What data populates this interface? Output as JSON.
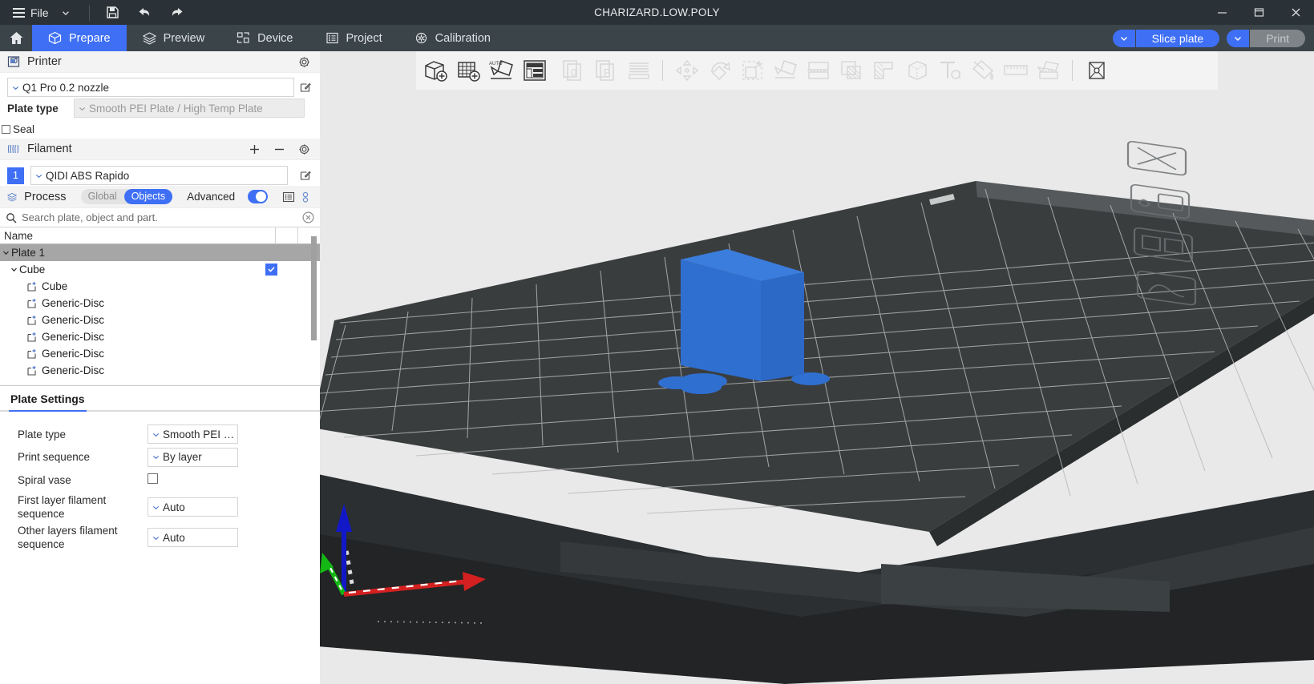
{
  "titlebar": {
    "file_menu": "File",
    "title": "CHARIZARD.LOW.POLY",
    "icons": [
      "hamburger-icon",
      "chevron-down-icon",
      "save-icon",
      "undo-icon",
      "redo-icon"
    ],
    "window_buttons": [
      "minimize-icon",
      "maximize-icon",
      "close-icon"
    ]
  },
  "tabs": {
    "home_icon": "home-icon",
    "items": [
      {
        "label": "Prepare",
        "icon": "cube-icon",
        "active": true
      },
      {
        "label": "Preview",
        "icon": "layers-icon",
        "active": false
      },
      {
        "label": "Device",
        "icon": "device-icon",
        "active": false
      },
      {
        "label": "Project",
        "icon": "project-icon",
        "active": false
      },
      {
        "label": "Calibration",
        "icon": "calibration-icon",
        "active": false
      }
    ],
    "slice_button": "Slice plate",
    "print_button": "Print"
  },
  "printer": {
    "section_title": "Printer",
    "gear_icon": "gear-icon",
    "preset": "Q1 Pro 0.2 nozzle",
    "edit_icon": "edit-icon",
    "plate_type_label": "Plate type",
    "plate_type_value": "Smooth PEI Plate / High Temp Plate",
    "seal_label": "Seal",
    "seal_checked": false
  },
  "filament": {
    "section_title": "Filament",
    "add_icon": "plus-icon",
    "remove_icon": "minus-icon",
    "gear_icon": "gear-icon",
    "rows": [
      {
        "index": "1",
        "name": "QIDI ABS Rapido",
        "edit_icon": "edit-icon"
      }
    ]
  },
  "process": {
    "section_title": "Process",
    "icon": "process-layers-icon",
    "segments": [
      {
        "label": "Global",
        "active": false
      },
      {
        "label": "Objects",
        "active": true
      }
    ],
    "advanced_label": "Advanced",
    "advanced_on": true,
    "list_icon": "list-view-icon",
    "settings_icon": "settings-dots-icon"
  },
  "search": {
    "icon": "search-icon",
    "placeholder": "Search plate, object and part.",
    "value": "",
    "clear_icon": "clear-circle-icon"
  },
  "object_table": {
    "columns": [
      "Name",
      "",
      ""
    ],
    "rows": [
      {
        "label": "Plate 1",
        "depth": 0,
        "type": "plate",
        "expanded": true,
        "selected": true,
        "checked": false
      },
      {
        "label": "Cube",
        "depth": 1,
        "type": "object",
        "expanded": true,
        "selected": false,
        "checked": true
      },
      {
        "label": "Cube",
        "depth": 2,
        "type": "part",
        "expanded": false,
        "selected": false,
        "checked": false
      },
      {
        "label": "Generic-Disc",
        "depth": 2,
        "type": "part",
        "expanded": false,
        "selected": false,
        "checked": false
      },
      {
        "label": "Generic-Disc",
        "depth": 2,
        "type": "part",
        "expanded": false,
        "selected": false,
        "checked": false
      },
      {
        "label": "Generic-Disc",
        "depth": 2,
        "type": "part",
        "expanded": false,
        "selected": false,
        "checked": false
      },
      {
        "label": "Generic-Disc",
        "depth": 2,
        "type": "part",
        "expanded": false,
        "selected": false,
        "checked": false
      },
      {
        "label": "Generic-Disc",
        "depth": 2,
        "type": "part",
        "expanded": false,
        "selected": false,
        "checked": false
      }
    ]
  },
  "plate_settings": {
    "title": "Plate Settings",
    "fields": [
      {
        "label": "Plate type",
        "control": "combo",
        "value": "Smooth PEI …"
      },
      {
        "label": "Print sequence",
        "control": "combo",
        "value": "By layer"
      },
      {
        "label": "Spiral vase",
        "control": "checkbox",
        "value": "",
        "checked": false
      },
      {
        "label": "First layer filament sequence",
        "control": "combo",
        "value": "Auto"
      },
      {
        "label": "Other layers filament sequence",
        "control": "combo",
        "value": "Auto"
      }
    ]
  },
  "view_toolbar": {
    "icons": [
      "add-object-icon",
      "add-plate-icon",
      "auto-arrange-icon",
      "layout-icon",
      "add-filament-0-icon",
      "add-filament-p-icon",
      "variable-layer-height-icon",
      "move-icon",
      "rotate-icon",
      "scale-icon",
      "place-on-face-icon",
      "cut-icon",
      "support-painting-icon",
      "seam-painting-icon",
      "fuzzy-skin-icon",
      "text-icon",
      "color-painting-icon",
      "measure-icon",
      "assembly-icon",
      "simplify-icon"
    ],
    "separator_positions": [
      6,
      19
    ]
  },
  "viewport": {
    "plate_color": "#3a3d3e",
    "grid_color": "#b8b8b8",
    "model_color": "#2f6fd0",
    "model_top_color": "#3b7ddd",
    "axes": {
      "x": "#d42020",
      "y": "#14b814",
      "z": "#1218c8"
    }
  }
}
